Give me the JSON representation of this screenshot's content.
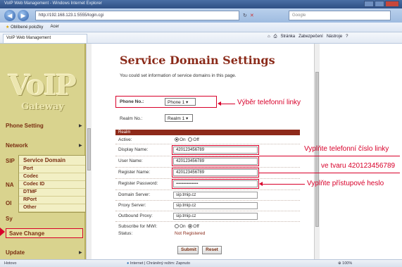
{
  "window": {
    "title": "VoIP Web Management - Windows Internet Explorer",
    "address": "http://192.168.123.1:5555/login.cgi",
    "search_placeholder": "Google"
  },
  "favorites": {
    "label": "Oblíbené položky",
    "item": "Acer"
  },
  "tab": {
    "label": "VoIP Web Management"
  },
  "commandbar": [
    "Stránka",
    "Zabezpečení",
    "Nástroje"
  ],
  "sidebar": {
    "logo": "VoIP",
    "logo_sub": "Gateway",
    "phone_setting": "Phone Setting",
    "network": "Network",
    "sip_prefix": "SIP",
    "na_prefix": "NA",
    "ot_prefix": "OI",
    "sys_prefix": "Sy",
    "submenu": [
      "Service Domain",
      "Port",
      "Codec",
      "Codec ID",
      "DTMF",
      "RPort",
      "Other"
    ],
    "save_change": "Save Change",
    "update": "Update"
  },
  "main": {
    "title": "Service Domain Settings",
    "intro": "You could set information of service domains in this page.",
    "phone_no_label": "Phone No.:",
    "phone_no_value": "Phone 1",
    "realm_no_label": "Realm No.:",
    "realm_no_value": "Realm 1",
    "section": "Realm",
    "fields": {
      "active_label": "Active:",
      "active_on": "On",
      "active_off": "Off",
      "display_name_label": "Display Name:",
      "display_name": "420123456789",
      "user_name_label": "User Name:",
      "user_name": "420123456789",
      "register_name_label": "Register Name:",
      "register_name": "420123456789",
      "register_password_label": "Register Password:",
      "register_password": "••••••••••••••••••",
      "domain_server_label": "Domain Server:",
      "domain_server": "sip.tmip.cz",
      "proxy_server_label": "Proxy Server:",
      "proxy_server": "sip.tmip.cz",
      "outbound_proxy_label": "Outbound Proxy:",
      "outbound_proxy": "sip.tmip.cz",
      "subscribe_mwi_label": "Subscribe for MWI:",
      "subscribe_on": "On",
      "subscribe_off": "Off",
      "status_label": "Status:",
      "status_value": "Not Registered"
    },
    "submit": "Submit",
    "reset": "Reset"
  },
  "annotations": {
    "phone_line": "Výběr telefonní linky",
    "phone_number_1": "Vyplňte telefonní číslo linky",
    "phone_number_2": "ve tvaru 420123456789",
    "password": "Vyplňte přístupové heslo"
  },
  "statusbar": {
    "left": "Hotovo",
    "middle": "Internet | Chráněný režim: Zapnuto",
    "zoom": "100%"
  },
  "colors": {
    "accent": "#8b2b1a",
    "annotation": "#d8002a",
    "sidebar": "#d9d38e"
  }
}
